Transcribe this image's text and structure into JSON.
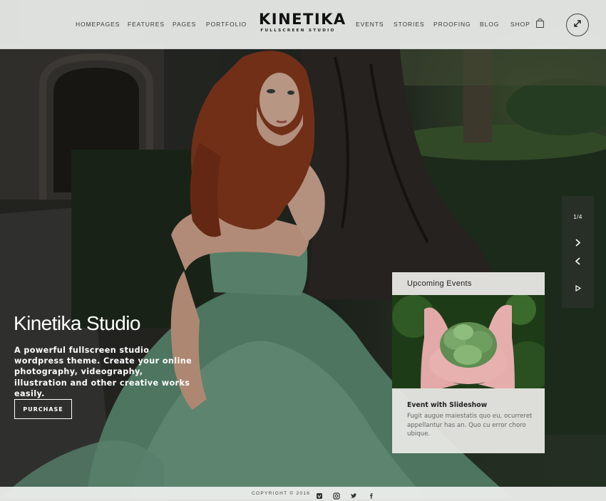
{
  "header": {
    "nav_left": [
      "HOMEPAGES",
      "FEATURES",
      "PAGES",
      "PORTFOLIO"
    ],
    "nav_right": [
      "EVENTS",
      "STORIES",
      "PROOFING",
      "BLOG",
      "SHOP"
    ],
    "logo_title": "KINETIKA",
    "logo_subtitle": "FULLSCREEN STUDIO",
    "cart_icon": "shopping-bag-icon",
    "fullscreen_icon": "expand-arrows-icon"
  },
  "hero": {
    "title": "Kinetika Studio",
    "description": "A powerful fullscreen studio wordpress theme. Create your online photography, videography, illustration and other creative works easily.",
    "button_label": "PURCHASE"
  },
  "slider": {
    "counter": "1/4",
    "next_icon": "chevron-right-icon",
    "prev_icon": "chevron-left-icon",
    "play_icon": "play-icon"
  },
  "events_card": {
    "heading": "Upcoming Events",
    "event_title": "Event with Slideshow",
    "event_description": "Fugit augue maiestatis quo eu, ocurreret appellantur has an. Quo cu error choro ubique."
  },
  "footer": {
    "copyright": "COPYRIGHT © 2016",
    "social_icons": [
      "vimeo-icon",
      "instagram-icon",
      "twitter-icon",
      "facebook-icon"
    ]
  },
  "colors": {
    "header_bg": "#eceeec",
    "dress": "#5f8f76",
    "hair": "#8a3a1e"
  }
}
